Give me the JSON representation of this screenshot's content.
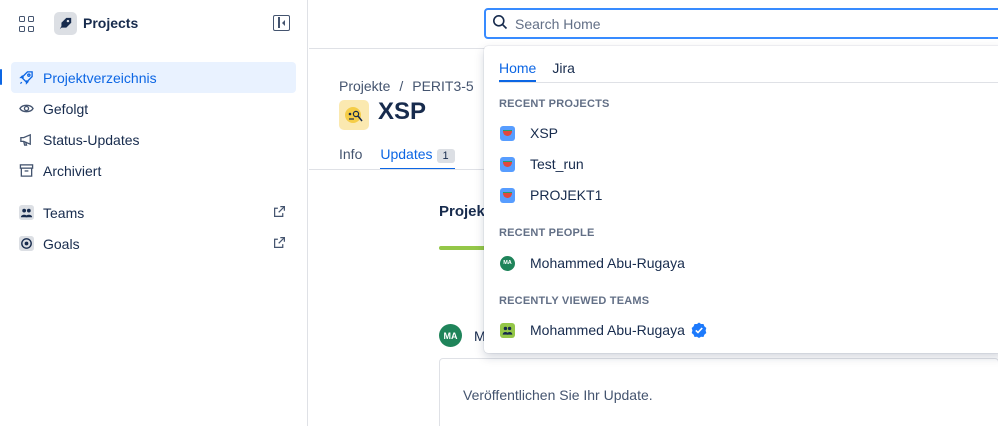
{
  "sidebar": {
    "title": "Projects",
    "items": [
      {
        "label": "Projektverzeichnis",
        "icon": "rocket-outline-icon"
      },
      {
        "label": "Gefolgt",
        "icon": "eye-icon"
      },
      {
        "label": "Status-Updates",
        "icon": "megaphone-icon"
      },
      {
        "label": "Archiviert",
        "icon": "archive-icon"
      },
      {
        "label": "Teams",
        "icon": "people-icon"
      },
      {
        "label": "Goals",
        "icon": "target-icon"
      }
    ]
  },
  "search": {
    "placeholder": "Search Home",
    "tabs": [
      "Home",
      "Jira"
    ],
    "sections": {
      "recent_projects": "RECENT PROJECTS",
      "recent_people": "RECENT PEOPLE",
      "recently_viewed_teams": "RECENTLY VIEWED TEAMS"
    },
    "projects": [
      "XSP",
      "Test_run",
      "PROJEKT1"
    ],
    "people": [
      {
        "name": "Mohammed Abu-Rugaya",
        "initials": "MA"
      }
    ],
    "teams": [
      {
        "name": "Mohammed Abu-Rugaya"
      }
    ]
  },
  "main": {
    "breadcrumb": [
      "Projekte",
      "/",
      "PERIT3-5"
    ],
    "project_title": "XSP",
    "tabs": [
      {
        "label": "Info"
      },
      {
        "label": "Updates",
        "badge": "1"
      }
    ],
    "section_title": "Projek",
    "progress": 0.12,
    "author_initials": "MA",
    "author_name": "M",
    "update_placeholder": "Veröffentlichen Sie Ihr Update."
  },
  "colors": {
    "accent": "#0c66e4",
    "active_bg": "#e9f2ff",
    "avatar_green": "#1f845a",
    "progress": "#94c748"
  }
}
